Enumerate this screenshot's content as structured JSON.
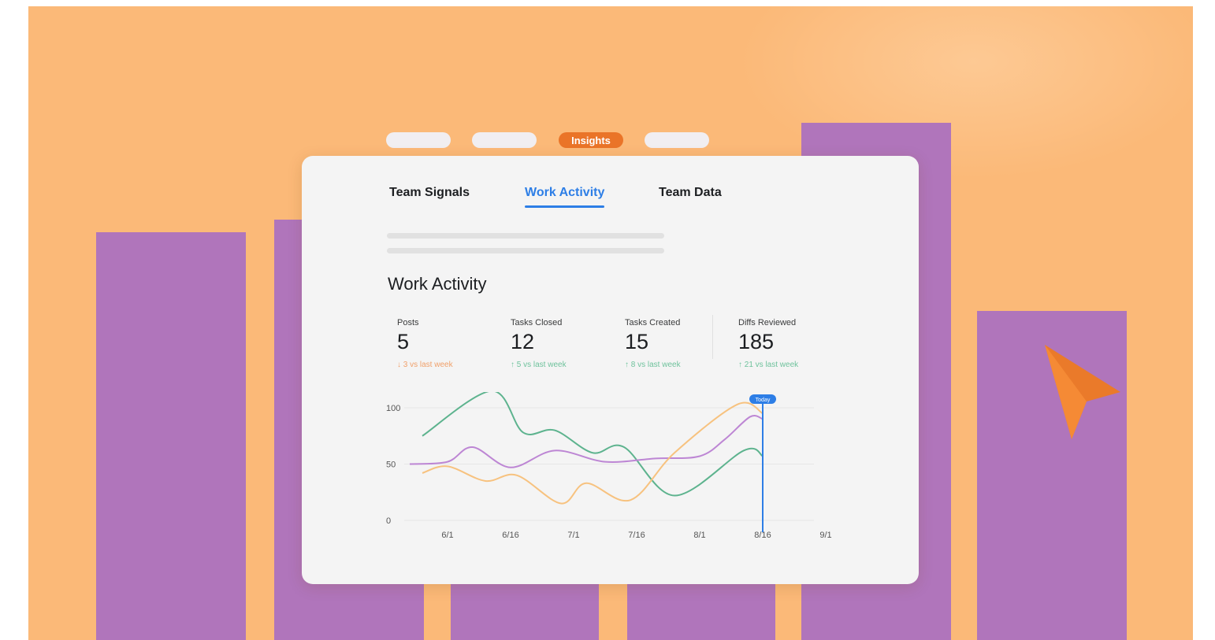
{
  "nav_pills": {
    "active_label": "Insights"
  },
  "tabs": [
    {
      "label": "Team Signals"
    },
    {
      "label": "Work Activity"
    },
    {
      "label": "Team Data"
    }
  ],
  "section_title": "Work Activity",
  "metrics": [
    {
      "label": "Posts",
      "value": "5",
      "delta": "↓ 3 vs last week",
      "trend": "down"
    },
    {
      "label": "Tasks Closed",
      "value": "12",
      "delta": "↑ 5 vs last week",
      "trend": "up"
    },
    {
      "label": "Tasks Created",
      "value": "15",
      "delta": "↑ 8 vs last week",
      "trend": "up"
    },
    {
      "label": "Diffs Reviewed",
      "value": "185",
      "delta": "↑ 21 vs last week",
      "trend": "up"
    }
  ],
  "colors": {
    "background": "#fbb978",
    "bars": "#b075bb",
    "accent_orange": "#ea7428",
    "accent_blue": "#2d7ee6",
    "series_green": "#5db38e",
    "series_purple": "#bd86d4",
    "series_orange": "#f7c27f"
  },
  "chart_data": {
    "type": "line",
    "x_ticks": [
      "6/1",
      "6/16",
      "7/1",
      "7/16",
      "8/1",
      "8/16",
      "9/1"
    ],
    "y_ticks": [
      "0",
      "50",
      "100"
    ],
    "ylim": [
      0,
      100
    ],
    "today_label": "Today",
    "today_x": "8/16",
    "series": [
      {
        "color": "#5db38e",
        "points": [
          [
            -0.4,
            75
          ],
          [
            0.7,
            115
          ],
          [
            1.2,
            78
          ],
          [
            1.7,
            80
          ],
          [
            2.3,
            60
          ],
          [
            2.8,
            65
          ],
          [
            3.6,
            22
          ],
          [
            4.7,
            62
          ],
          [
            5,
            57
          ]
        ]
      },
      {
        "color": "#bd86d4",
        "points": [
          [
            -0.6,
            50
          ],
          [
            0,
            52
          ],
          [
            0.4,
            65
          ],
          [
            1,
            47
          ],
          [
            1.7,
            62
          ],
          [
            2.5,
            52
          ],
          [
            3.3,
            55
          ],
          [
            4,
            57
          ],
          [
            4.4,
            72
          ],
          [
            4.8,
            92
          ],
          [
            5,
            90
          ]
        ]
      },
      {
        "color": "#f7c27f",
        "points": [
          [
            -0.4,
            42
          ],
          [
            0,
            48
          ],
          [
            0.6,
            35
          ],
          [
            1.1,
            40
          ],
          [
            1.8,
            15
          ],
          [
            2.2,
            33
          ],
          [
            2.9,
            18
          ],
          [
            3.6,
            60
          ],
          [
            4.6,
            103
          ],
          [
            5,
            95
          ]
        ]
      }
    ]
  }
}
